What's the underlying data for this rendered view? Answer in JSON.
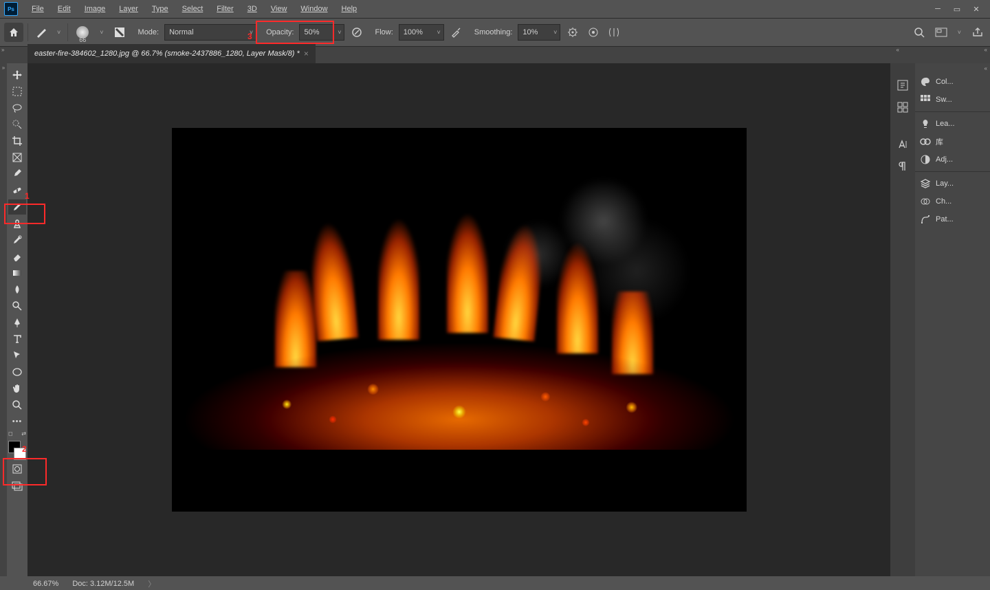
{
  "menubar": {
    "items": [
      "File",
      "Edit",
      "Image",
      "Layer",
      "Type",
      "Select",
      "Filter",
      "3D",
      "View",
      "Window",
      "Help"
    ]
  },
  "optionsbar": {
    "brush_size": "66",
    "mode_label": "Mode:",
    "mode_value": "Normal",
    "opacity_label": "Opacity:",
    "opacity_value": "50%",
    "flow_label": "Flow:",
    "flow_value": "100%",
    "smoothing_label": "Smoothing:",
    "smoothing_value": "10%"
  },
  "tab": {
    "title": "easter-fire-384602_1280.jpg @ 66.7% (smoke-2437886_1280, Layer Mask/8) *"
  },
  "right_panels": {
    "items": [
      {
        "icon": "palette",
        "label": "Col..."
      },
      {
        "icon": "swatch",
        "label": "Sw..."
      },
      {
        "icon": "bulb",
        "label": "Lea..."
      },
      {
        "icon": "cc",
        "label": "库"
      },
      {
        "icon": "sliders",
        "label": "Adj..."
      },
      {
        "icon": "layers",
        "label": "Lay..."
      },
      {
        "icon": "channels",
        "label": "Ch..."
      },
      {
        "icon": "paths",
        "label": "Pat..."
      }
    ]
  },
  "status": {
    "zoom": "66.67%",
    "doc": "Doc: 3.12M/12.5M"
  },
  "annotations": {
    "one": "1",
    "two": "2",
    "three": "3"
  }
}
